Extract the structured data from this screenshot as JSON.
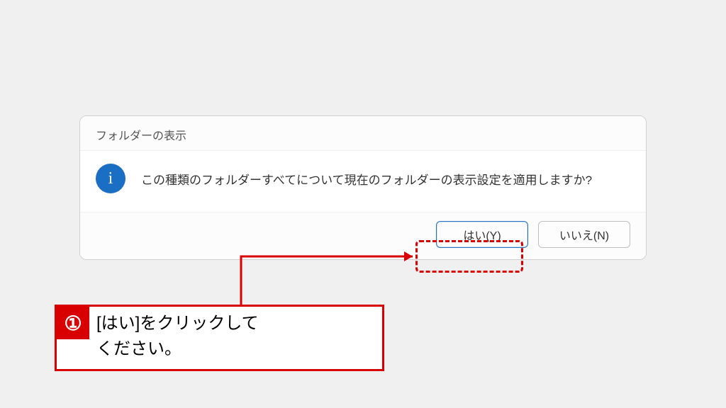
{
  "dialog": {
    "title": "フォルダーの表示",
    "message": "この種類のフォルダーすべてについて現在のフォルダーの表示設定を適用しますか?",
    "yes_label": "はい(Y)",
    "no_label": "いいえ(N)"
  },
  "callout": {
    "number": "①",
    "text_line1": "[はい]をクリックして",
    "text_line2": "ください。"
  },
  "colors": {
    "accent_red": "#d80000",
    "info_blue": "#1a6fc4",
    "focus_blue": "#2a72c4"
  }
}
